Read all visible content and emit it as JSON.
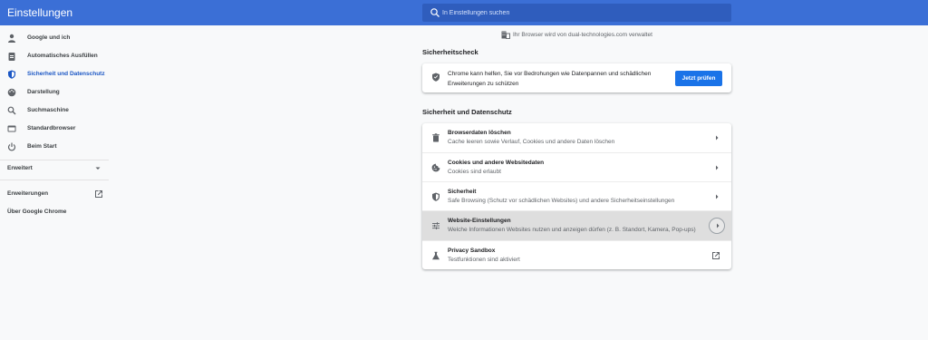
{
  "app": {
    "title": "Einstellungen"
  },
  "search": {
    "placeholder": "In Einstellungen suchen"
  },
  "sidebar": {
    "items": [
      {
        "label": "Google und ich",
        "icon": "person-icon"
      },
      {
        "label": "Automatisches Ausfüllen",
        "icon": "clipboard-icon"
      },
      {
        "label": "Sicherheit und Datenschutz",
        "icon": "shield-icon",
        "active": true
      },
      {
        "label": "Darstellung",
        "icon": "palette-icon"
      },
      {
        "label": "Suchmaschine",
        "icon": "search-icon"
      },
      {
        "label": "Standardbrowser",
        "icon": "browser-icon"
      },
      {
        "label": "Beim Start",
        "icon": "power-icon"
      }
    ],
    "advanced_label": "Erweitert",
    "extensions_label": "Erweiterungen",
    "about_label": "Über Google Chrome"
  },
  "managed_notice": "Ihr Browser wird von dual-technologies.com verwaltet",
  "safety_check": {
    "title": "Sicherheitscheck",
    "text": "Chrome kann helfen, Sie vor Bedrohungen wie Datenpannen und schädlichen Erweiterungen zu schützen",
    "button": "Jetzt prüfen"
  },
  "privacy": {
    "title": "Sicherheit und Datenschutz",
    "rows": [
      {
        "title": "Browserdaten löschen",
        "subtitle": "Cache leeren sowie Verlauf, Cookies und andere Daten löschen",
        "icon": "trash-icon"
      },
      {
        "title": "Cookies und andere Websitedaten",
        "subtitle": "Cookies sind erlaubt",
        "icon": "cookie-icon"
      },
      {
        "title": "Sicherheit",
        "subtitle": "Safe Browsing (Schutz vor schädlichen Websites) und andere Sicherheitseinstellungen",
        "icon": "shield-icon"
      },
      {
        "title": "Website-Einstellungen",
        "subtitle": "Welche Informationen Websites nutzen und anzeigen dürfen (z. B. Standort, Kamera, Pop-ups)",
        "icon": "sliders-icon"
      },
      {
        "title": "Privacy Sandbox",
        "subtitle": "Testfunktionen sind aktiviert",
        "icon": "flask-icon"
      }
    ]
  },
  "colors": {
    "header": "#3b6fd6",
    "accent": "#1a73e8",
    "active_nav": "#1a56c4"
  }
}
